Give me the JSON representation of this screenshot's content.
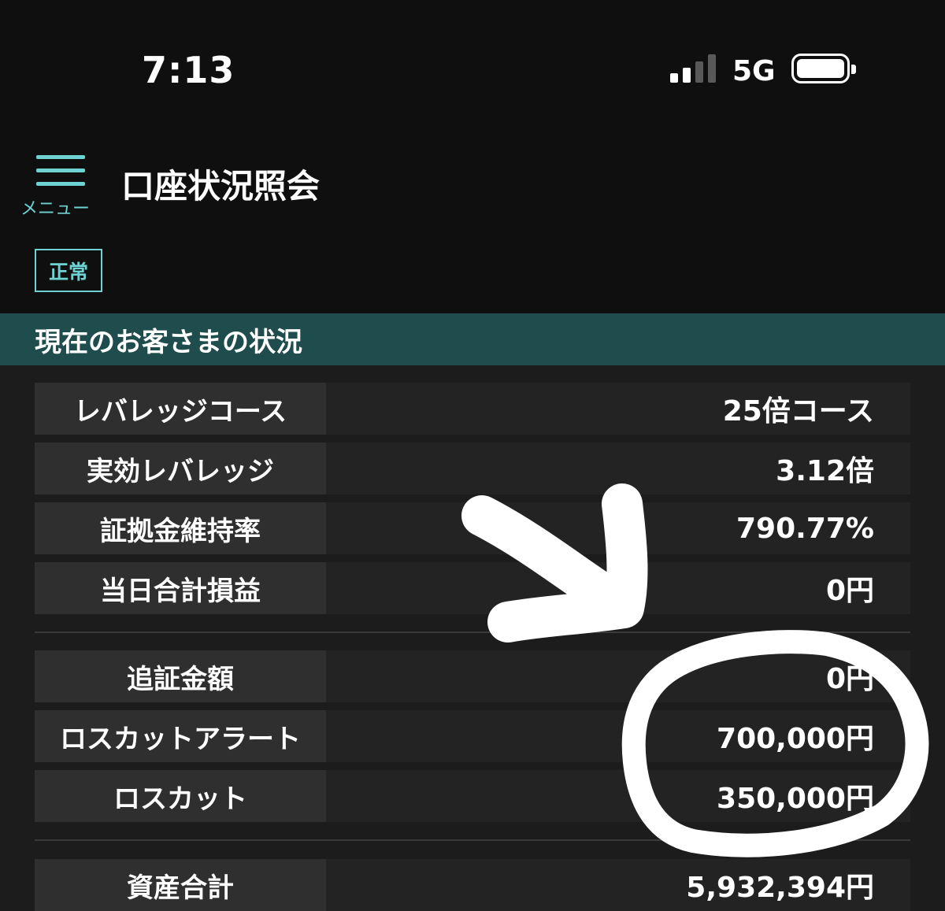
{
  "status_bar": {
    "time": "7:13",
    "network": "5G",
    "icons": [
      "signal-icon",
      "battery-icon"
    ]
  },
  "header": {
    "menu_label": "メニュー",
    "menu_icon": "hamburger-icon",
    "title": "口座状況照会"
  },
  "status_badge": "正常",
  "section": {
    "title": "現在のお客さまの状況"
  },
  "rows": [
    {
      "label": "レバレッジコース",
      "value": "25倍コース"
    },
    {
      "label": "実効レバレッジ",
      "value": "3.12倍"
    },
    {
      "label": "証拠金維持率",
      "value": "790.77%"
    },
    {
      "label": "当日合計損益",
      "value": "0円"
    },
    {
      "label": "追証金額",
      "value": "0円"
    },
    {
      "label": "ロスカットアラート",
      "value": "700,000円"
    },
    {
      "label": "ロスカット",
      "value": "350,000円"
    },
    {
      "label": "資産合計",
      "value": "5,932,394円"
    }
  ],
  "colors": {
    "accent": "#6fd2d2",
    "section_header": "#1f4c4c",
    "background": "#1c1c1c",
    "top_background": "#0f0f0f"
  },
  "overlay": {
    "annotations": [
      "hand-drawn-arrow",
      "hand-drawn-circle"
    ]
  }
}
